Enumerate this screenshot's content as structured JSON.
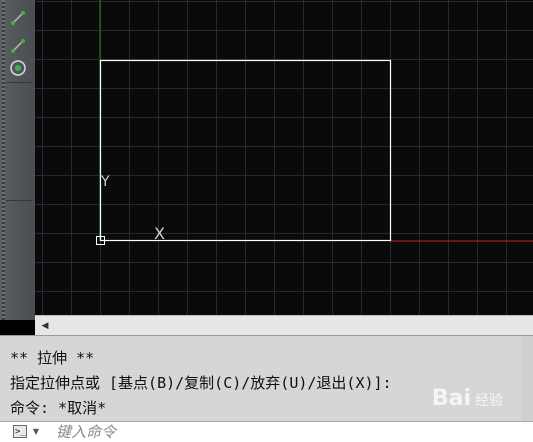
{
  "toolbar": {
    "buttons": [
      {
        "icon": "polyline-icon"
      },
      {
        "icon": "line-icon"
      },
      {
        "icon": "circle-target-icon"
      }
    ]
  },
  "canvas": {
    "background": "#000000",
    "grid_color": "#2a2c3a",
    "line_color": "#ffffff",
    "x_axis_color": "#c62020",
    "y_axis_color": "#1f8a1f",
    "ucs_y_label": "Y",
    "ucs_x_label": "X"
  },
  "command": {
    "history": [
      "** 拉伸 **",
      "指定拉伸点或 [基点(B)/复制(C)/放弃(U)/退出(X)]:",
      "命令: *取消*"
    ],
    "input_placeholder": "键入命令",
    "prompt_icon": ">_"
  },
  "watermark": {
    "text": "Bai",
    "suffix": "经验"
  }
}
